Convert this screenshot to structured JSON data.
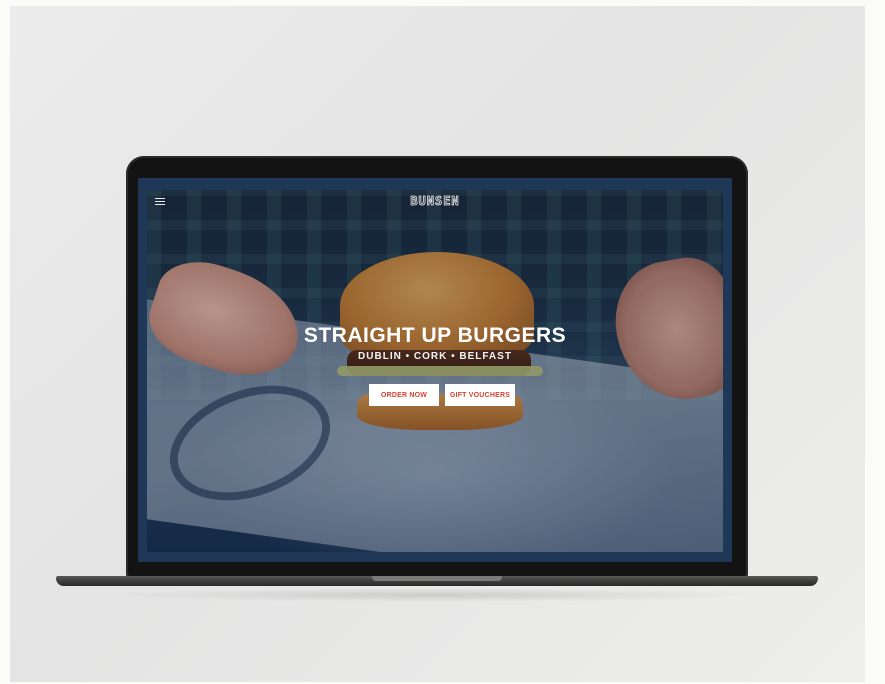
{
  "site": {
    "logo": "BUNSEN",
    "menu_icon": "hamburger-menu-icon"
  },
  "hero": {
    "headline": "STRAIGHT UP BURGERS",
    "locations": "DUBLIN • CORK • BELFAST",
    "order_label": "ORDER NOW",
    "gift_label": "GIFT VOUCHERS"
  },
  "colors": {
    "button_text": "#d8412f",
    "button_bg": "#ffffff",
    "screen_frame": "#1f3857"
  }
}
